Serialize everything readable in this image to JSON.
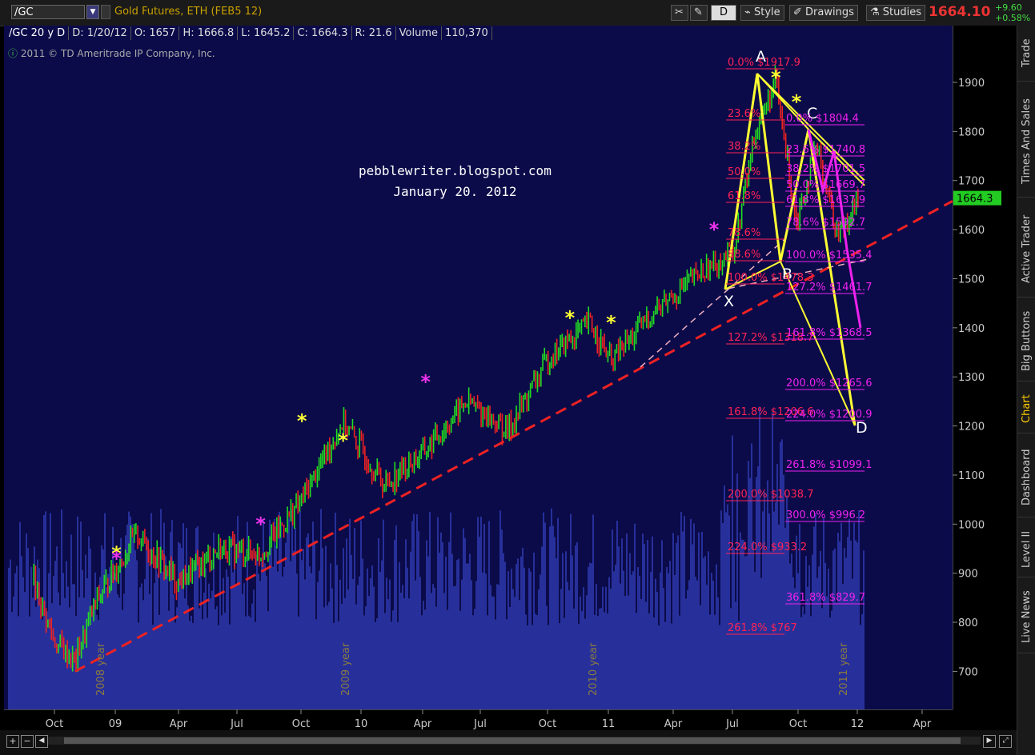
{
  "toolbar": {
    "symbol": "/GC",
    "description": "Gold Futures, ETH (FEB5 12)",
    "period_btn": "D",
    "style_btn": "Style",
    "drawings_btn": "Drawings",
    "studies_btn": "Studies",
    "last_price": "1664.10",
    "change_up": "+9.60",
    "change_pct": "+0.58%"
  },
  "info": {
    "series": "/GC 20 y D",
    "date": "D: 1/20/12",
    "open": "O: 1657",
    "high": "H: 1666.8",
    "low": "L: 1645.2",
    "close": "C: 1664.3",
    "range": "R: 21.6",
    "volume_label": "Volume",
    "volume": "110,370"
  },
  "copyright": "2011 © TD Ameritrade IP Company, Inc.",
  "watermark": {
    "line1": "pebblewriter.blogspot.com",
    "line2": "January 20. 2012"
  },
  "sidebar": [
    "Trade",
    "Times And Sales",
    "Active Trader",
    "Big Buttons",
    "Chart",
    "Dashboard",
    "Level II",
    "Live News"
  ],
  "colors": {
    "plot_bg": "#0b0b4a",
    "up": "#22dd22",
    "down": "#ee2222",
    "volume": "#27309a",
    "trend": "#ee2222",
    "harmonic": "#ffff33",
    "fib_red": "#ff2255",
    "fib_magenta": "#ee22ee",
    "last_label": "#22cc22"
  },
  "chart_data": {
    "type": "candlestick",
    "title": "",
    "y_ticks": [
      700,
      800,
      900,
      1000,
      1100,
      1200,
      1300,
      1400,
      1500,
      1600,
      1700,
      1800,
      1900
    ],
    "x_ticks": [
      "Oct",
      "09",
      "Apr",
      "Jul",
      "Oct",
      "10",
      "Apr",
      "Jul",
      "Oct",
      "11",
      "Apr",
      "Jul",
      "Oct",
      "12",
      "Apr"
    ],
    "year_markers": [
      "2008 year",
      "2009 year",
      "2010 year",
      "2011 year"
    ],
    "last_label": "1664.3",
    "trendline": [
      {
        "x": "2008-11",
        "y": 700
      },
      {
        "x": "2012-02",
        "y": 1650
      }
    ],
    "path_points": [
      {
        "x": "2008-09",
        "y": 880
      },
      {
        "x": "2008-10",
        "y": 760
      },
      {
        "x": "2008-11",
        "y": 720
      },
      {
        "x": "2008-12",
        "y": 840
      },
      {
        "x": "2009-02",
        "y": 980
      },
      {
        "x": "2009-04",
        "y": 880
      },
      {
        "x": "2009-06",
        "y": 950
      },
      {
        "x": "2009-08",
        "y": 940
      },
      {
        "x": "2009-10",
        "y": 1050
      },
      {
        "x": "2009-12",
        "y": 1210
      },
      {
        "x": "2010-02",
        "y": 1080
      },
      {
        "x": "2010-04",
        "y": 1150
      },
      {
        "x": "2010-06",
        "y": 1250
      },
      {
        "x": "2010-08",
        "y": 1190
      },
      {
        "x": "2010-10",
        "y": 1340
      },
      {
        "x": "2010-12",
        "y": 1410
      },
      {
        "x": "2011-01",
        "y": 1330
      },
      {
        "x": "2011-03",
        "y": 1430
      },
      {
        "x": "2011-05",
        "y": 1500
      },
      {
        "x": "2011-07",
        "y": 1560
      },
      {
        "x": "2011-08",
        "y": 1800
      },
      {
        "x": "2011-09",
        "y": 1900
      },
      {
        "x": "2011-10",
        "y": 1620
      },
      {
        "x": "2011-11",
        "y": 1770
      },
      {
        "x": "2011-12",
        "y": 1590
      },
      {
        "x": "2012-01",
        "y": 1664
      }
    ],
    "harmonic_points": [
      {
        "label": "X",
        "y": 1478.3
      },
      {
        "label": "A",
        "y": 1917.9
      },
      {
        "label": "B",
        "y": 1535
      },
      {
        "label": "C",
        "y": 1804.4
      },
      {
        "label": "D",
        "y": 1200.9
      }
    ],
    "fib_levels_red": [
      {
        "pct": "0.0%",
        "price": "$1917.9"
      },
      {
        "pct": "23.6%",
        "price": ""
      },
      {
        "pct": "38.2%",
        "price": ""
      },
      {
        "pct": "50.0%",
        "price": ""
      },
      {
        "pct": "61.8%",
        "price": ""
      },
      {
        "pct": "78.6%",
        "price": ""
      },
      {
        "pct": "88.6%",
        "price": ""
      },
      {
        "pct": "100.0%",
        "price": "$1478.3"
      },
      {
        "pct": "127.2%",
        "price": "$1318.7"
      },
      {
        "pct": "161.8%",
        "price": "$1206.6"
      },
      {
        "pct": "200.0%",
        "price": "$1038.7"
      },
      {
        "pct": "224.0%",
        "price": "$933.2"
      },
      {
        "pct": "261.8%",
        "price": "$767"
      }
    ],
    "fib_levels_magenta": [
      {
        "pct": "0.0%",
        "price": "$1804.4"
      },
      {
        "pct": "23.6%",
        "price": "$1740.8"
      },
      {
        "pct": "38.2%",
        "price": "$1701.5"
      },
      {
        "pct": "50.0%",
        "price": "$1669.7"
      },
      {
        "pct": "61.8%",
        "price": "$1637.9"
      },
      {
        "pct": "78.6%",
        "price": "$1592.7"
      },
      {
        "pct": "100.0%",
        "price": "$1535.4"
      },
      {
        "pct": "127.2%",
        "price": "$1461.7"
      },
      {
        "pct": "161.8%",
        "price": "$1368.5"
      },
      {
        "pct": "200.0%",
        "price": "$1265.6"
      },
      {
        "pct": "224.0%",
        "price": "$1200.9"
      },
      {
        "pct": "261.8%",
        "price": "$1099.1"
      },
      {
        "pct": "300.0%",
        "price": "$996.2"
      },
      {
        "pct": "361.8%",
        "price": "$829.7"
      }
    ],
    "star_markers": [
      {
        "x": "2009-01",
        "y": 940,
        "color": "yellow"
      },
      {
        "x": "2009-01",
        "y": 930,
        "color": "magenta"
      },
      {
        "x": "2009-08",
        "y": 1000,
        "color": "magenta"
      },
      {
        "x": "2009-10",
        "y": 1210,
        "color": "yellow"
      },
      {
        "x": "2009-12",
        "y": 1170,
        "color": "yellow"
      },
      {
        "x": "2010-04",
        "y": 1290,
        "color": "magenta"
      },
      {
        "x": "2010-11",
        "y": 1420,
        "color": "yellow"
      },
      {
        "x": "2011-01",
        "y": 1410,
        "color": "yellow"
      },
      {
        "x": "2011-06",
        "y": 1600,
        "color": "magenta"
      },
      {
        "x": "2011-09",
        "y": 1910,
        "color": "yellow"
      },
      {
        "x": "2011-10",
        "y": 1860,
        "color": "yellow"
      }
    ]
  }
}
